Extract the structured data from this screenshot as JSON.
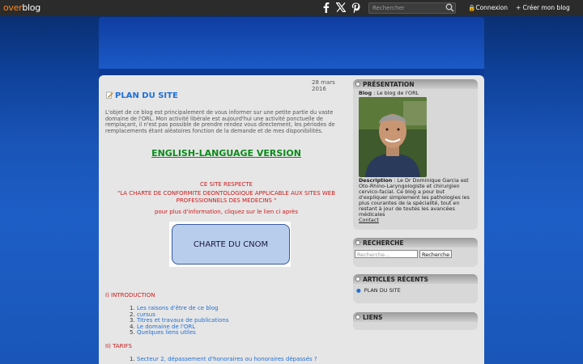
{
  "topbar": {
    "logo_part1": "over",
    "logo_part2": "blog",
    "search_placeholder": "Rechercher",
    "connexion": "Connexion",
    "creer": "Créer mon blog"
  },
  "post": {
    "date": "28 mars 2016",
    "title": "PLAN DU SITE",
    "intro": "L'objet de ce blog est principalement de vous informer sur une petite partie du vaste domaine de l'ORL. Mon activité libérale est aujourd'hui une activité ponctuelle de remplaçant, il n'est pas possible de prendre rendez vous directement, les périodes de remplacements étant aléatoires fonction de la demande et de mes disponibilités.",
    "english": "ENGLISH-LANGUAGE VERSION",
    "respect_line1": "CE SITE RESPECTE",
    "respect_line2": "\"LA  CHARTE DE CONFORMITE DEONTOLOGIQUE APPLICABLE AUX SITES WEB PROFESSIONNELS DES MEDECINS \"",
    "info": "pour plus d'information, cliquez sur le lien ci après",
    "cnom": "CHARTE DU CNOM",
    "section1": "I) INTRODUCTION",
    "section1_items": [
      "Les raisons d'être de ce blog",
      "cursus",
      "Titres et travaux de publications",
      "Le domaine de l'ORL",
      "Quelques liens utiles"
    ],
    "section2": "II) TARIFS",
    "section2_items": [
      "Secteur 2, dépassement d'honoraires ou honoraires dépassés ?"
    ]
  },
  "sidebar": {
    "presentation": {
      "title": "PRÉSENTATION",
      "blog_label": "Blog",
      "blog_value": " : Le blog de l'ORL",
      "desc_label": "Description",
      "desc_value": " : Le Dr Dominique Garcia est Oto-Rhino-Laryngologiste et chirurgien cervico-facial. Ce blog a pour but d'expliquer simplement les pathologies les plus courantes de la spécialité, tout en restant à jour de toutes les avancées médicales",
      "contact": "Contact"
    },
    "recherche": {
      "title": "RECHERCHE",
      "placeholder": "Recherche...",
      "button": "Recherche"
    },
    "articles": {
      "title": "ARTICLES RÉCENTS",
      "items": [
        "PLAN DU SITE"
      ]
    },
    "liens": {
      "title": "LIENS"
    }
  },
  "colors": {
    "accent": "#1f6fd6",
    "red": "#cc1a1a",
    "green": "#0a8a1a",
    "orange_logo": "#ff8a1e"
  }
}
